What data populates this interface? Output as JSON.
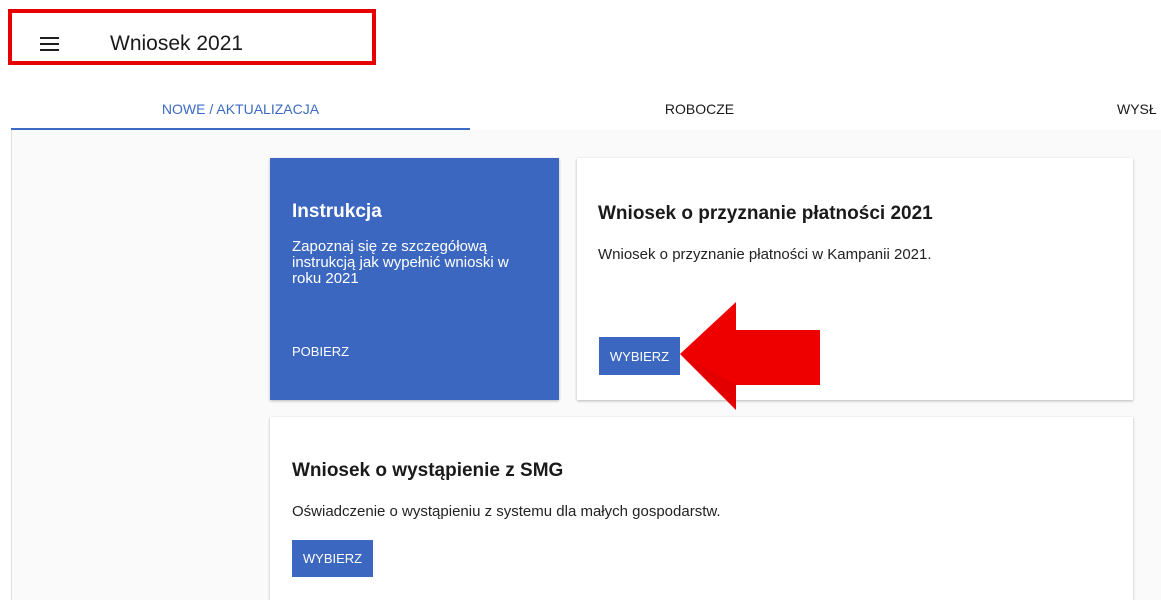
{
  "header": {
    "menu_icon": "hamburger-menu-icon",
    "title": "Wniosek 2021",
    "highlight_color": "#e60000"
  },
  "tabs": [
    {
      "label": "NOWE / AKTUALIZACJA",
      "active": true
    },
    {
      "label": "ROBOCZE",
      "active": false
    },
    {
      "label": "WYSŁ",
      "active": false
    }
  ],
  "cards": {
    "instructions": {
      "title": "Instrukcja",
      "text": "Zapoznaj się ze szczegółową instrukcją jak wypełnić wnioski w roku 2021",
      "action_label": "POBIERZ"
    },
    "payment": {
      "title": "Wniosek o przyznanie płatności 2021",
      "text": "Wniosek o przyznanie płatności w Kampanii 2021.",
      "action_label": "WYBIERZ"
    },
    "smg": {
      "title": "Wniosek o wystąpienie z SMG",
      "text": "Oświadczenie o wystąpieniu z systemu dla małych gospodarstw.",
      "action_label": "WYBIERZ"
    }
  },
  "annotation": {
    "arrow_icon": "red-arrow-left-icon",
    "color": "#ee0000"
  },
  "colors": {
    "accent": "#3b67c0",
    "active_tab": "#3b6bc4",
    "background": "#fafafa"
  }
}
